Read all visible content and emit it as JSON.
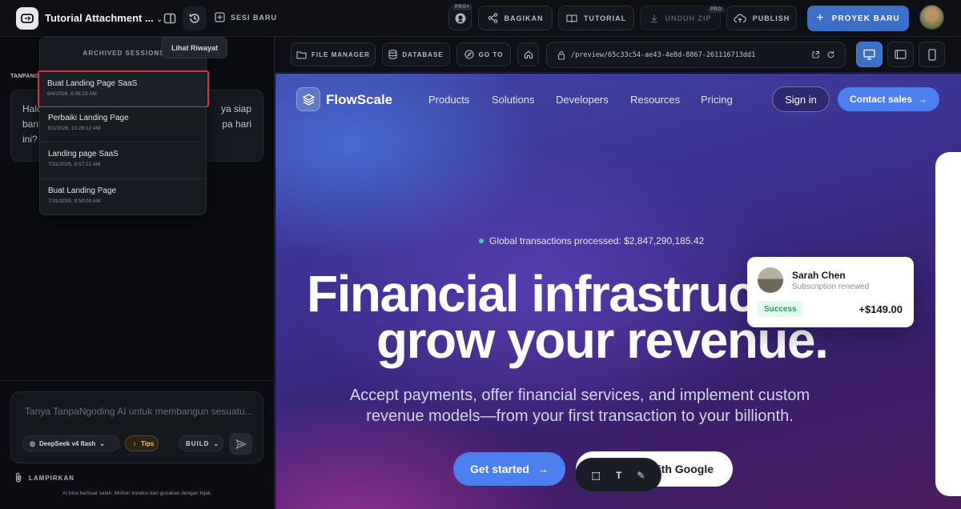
{
  "topbar": {
    "project_title": "Tutorial Attachment ...",
    "new_session_label": "SESI BARU",
    "pro_badge": "PRO+",
    "share_label": "BAGIKAN",
    "tutorial_label": "TUTORIAL",
    "download_label": "UNDUH ZIP",
    "download_badge": "PRO",
    "publish_label": "PUBLISH",
    "new_project_label": "PROYEK BARU"
  },
  "history": {
    "tooltip": "Lihat Riwayat",
    "title": "ARCHIVED SESSIONS",
    "items": [
      {
        "title": "Buat Landing Page SaaS",
        "date": "8/4/2026, 8:06:23 AM"
      },
      {
        "title": "Perbaiki Landing Page",
        "date": "8/1/2026, 10:28:12 AM"
      },
      {
        "title": "Landing page SaaS",
        "date": "7/31/2026, 8:57:21 AM"
      },
      {
        "title": "Buat Landing Page",
        "date": "7/31/2026, 8:50:00 AM"
      }
    ]
  },
  "chat": {
    "sender_label": "TANPANG",
    "message_line1": "Halo",
    "message_line1_end": "ya siap",
    "message_line2": "bant",
    "message_line2_end": "pa hari",
    "message_line3": "ini?",
    "composer_placeholder": "Tanya TanpaNgoding AI untuk membangun sesuatu...",
    "model_label": "DeepSeek v4 flash",
    "tips_label": "Tips",
    "mode_label": "BUILD",
    "attach_label": "LAMPIRKAN",
    "disclaimer": "AI bisa berbuat salah. Mohon koreksi dan gunakan dengan bijak."
  },
  "preview_toolbar": {
    "file_manager_label": "FILE MANAGER",
    "database_label": "DATABASE",
    "goto_label": "GO TO",
    "url": "/preview/65c33c54-ae43-4e8d-8867-261116713dd1",
    "active_view": "desktop"
  },
  "site": {
    "brand": "FlowScale",
    "nav": [
      "Products",
      "Solutions",
      "Developers",
      "Resources",
      "Pricing"
    ],
    "signin_label": "Sign in",
    "contact_label": "Contact sales",
    "ticker": "Global transactions processed: $2,847,290,185.42",
    "hero_line1": "Financial infrastruct",
    "hero_line2": "grow your revenue.",
    "subtitle": "Accept payments, offer financial services, and implement custom revenue models—from your first transaction to your billionth.",
    "cta_primary": "Get started",
    "cta_secondary": "with Google",
    "notification": {
      "name": "Sarah Chen",
      "status": "Subscription renewed",
      "badge": "Success",
      "amount": "+$149.00"
    },
    "float_text_tool": "T"
  },
  "colors": {
    "accent": "#3e6fc8",
    "highlight_border": "#d8323a",
    "site_cta": "#4c7ff0"
  }
}
